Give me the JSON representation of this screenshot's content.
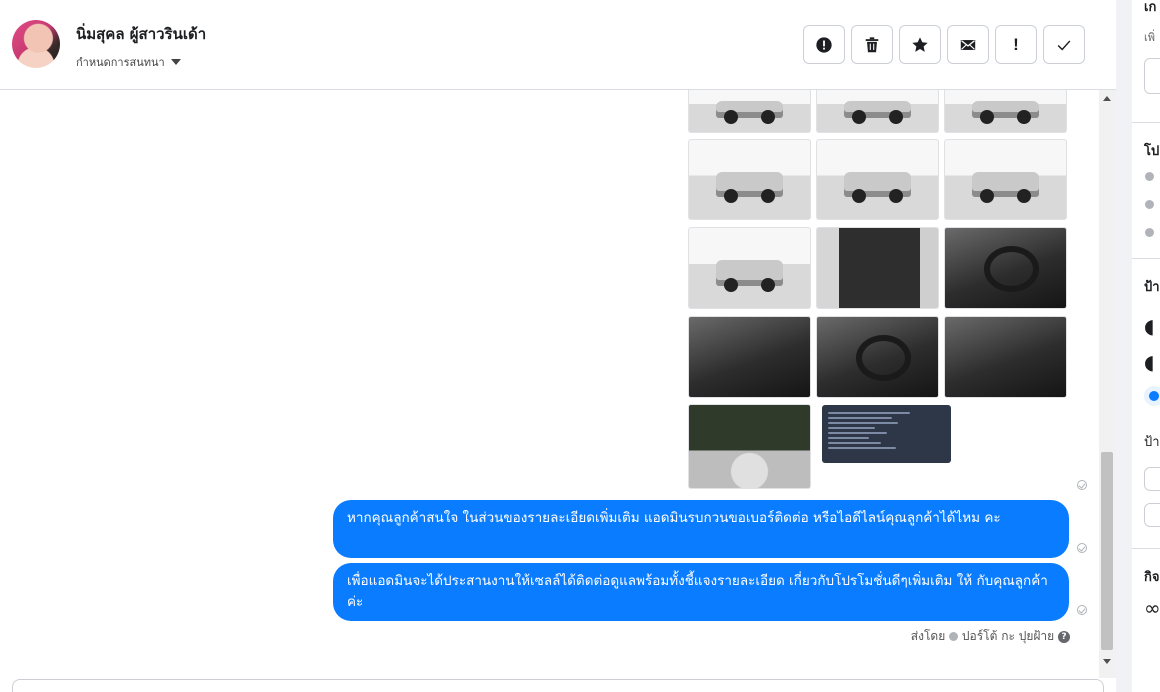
{
  "header": {
    "contact_name": "นิ่มสุคล ผู้สาวรินเด้า",
    "assign_label": "กำหนดการสนทนา",
    "actions": [
      {
        "name": "spam-button",
        "icon": "alert-circle-icon"
      },
      {
        "name": "delete-button",
        "icon": "trash-icon"
      },
      {
        "name": "star-button",
        "icon": "star-icon"
      },
      {
        "name": "mark-unread-button",
        "icon": "envelope-icon"
      },
      {
        "name": "follow-up-button",
        "icon": "exclamation-icon",
        "glyph": "!"
      },
      {
        "name": "done-button",
        "icon": "check-icon"
      }
    ]
  },
  "conversation": {
    "attachments_count": 14,
    "messages": [
      {
        "text": "หากคุณลูกค้าสนใจ ในส่วนของรายละเอียดเพิ่มเติม แอดมินรบกวนขอเบอร์ติดต่อ หรือไอดีไลน์คุณลูกค้าได้ไหม คะ"
      },
      {
        "text": "เพื่อแอดมินจะได้ประสานงานให้เซลล์ได้ติดต่อดูแลพร้อมทั้งชี้แจงรายละเอียด เกี่ยวกับโปรโมชั่นดีๆเพิ่มเติม ให้ กับคุณลูกค้าค่ะ"
      }
    ],
    "sent_by_label": "ส่งโดย",
    "sender_name": "ปอร์โต้ กะ ปุยฝ้าย",
    "help_glyph": "?"
  },
  "right_panel": {
    "section1_title": "เก",
    "section1_sub": "เพิ่",
    "section2_title": "โป",
    "section3_title": "ป้า",
    "section3_sub": "ป้า",
    "section4_title": "กิจ",
    "section4_glyph": "∞"
  },
  "colors": {
    "accent": "#0a7cff",
    "border": "#ccd0d5",
    "panel_bg": "#f0f2f5"
  }
}
